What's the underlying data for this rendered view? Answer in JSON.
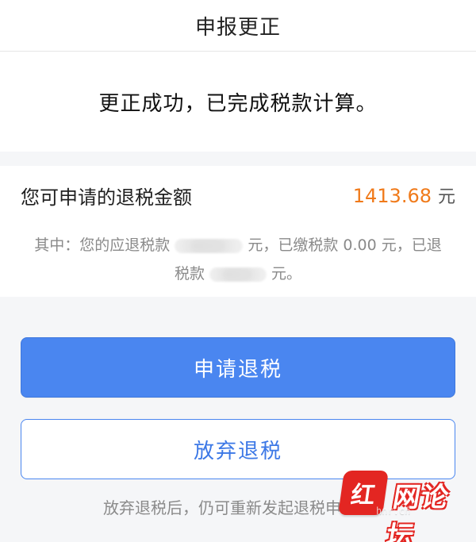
{
  "nav": {
    "title": "申报更正"
  },
  "success": {
    "message": "更正成功，已完成税款计算。"
  },
  "refund": {
    "label": "您可申请的退税金额",
    "amount": "1413.68",
    "unit": "元",
    "detail": {
      "prefix": "其中：您的应退税款",
      "masked_1_suffix": "元，已缴税款",
      "paid_amount": "0.00",
      "paid_suffix": "元，已退",
      "line2_prefix": "税款",
      "masked_2_suffix": "元。"
    }
  },
  "actions": {
    "apply_label": "申请退税",
    "abandon_label": "放弃退税"
  },
  "footer": {
    "note": "放弃退税后，仍可重新发起退税申请。"
  },
  "watermark": {
    "logo_char": "红",
    "brand_text": "网论坛",
    "url": "hnr.cn"
  },
  "colors": {
    "primary": "#4a86f0",
    "amount": "#f07a1a",
    "background": "#f5f6f8"
  },
  "icons": {
    "masked_value": "blurred-redaction"
  }
}
